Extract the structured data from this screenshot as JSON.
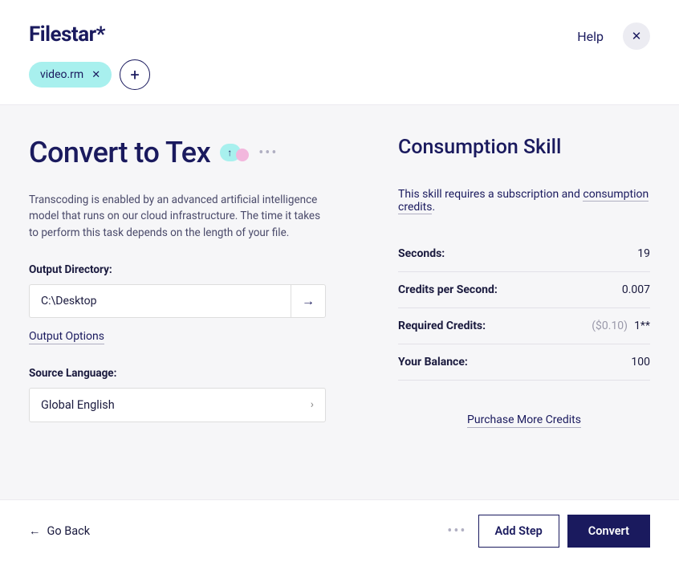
{
  "header": {
    "logo": "Filestar*",
    "file_chip": "video.rm",
    "help": "Help"
  },
  "main": {
    "title": "Convert to Tex",
    "description": "Transcoding is enabled by an advanced artificial intelligence model that runs on our cloud infrastructure. The time it takes to perform this task depends on the length of your file.",
    "output_dir_label": "Output Directory:",
    "output_dir_value": "C:\\Desktop",
    "output_options": "Output Options",
    "source_lang_label": "Source Language:",
    "source_lang_value": "Global English"
  },
  "consumption": {
    "title": "Consumption Skill",
    "req_pre": "This skill requires a subscription and ",
    "req_link": "consumption credits",
    "req_post": ".",
    "rows": [
      {
        "label": "Seconds:",
        "value": "19"
      },
      {
        "label": "Credits per Second:",
        "value": "0.007"
      },
      {
        "label": "Required Credits:",
        "cost": "($0.10)",
        "value": "1**"
      },
      {
        "label": "Your Balance:",
        "value": "100"
      }
    ],
    "purchase": "Purchase More Credits"
  },
  "footer": {
    "back": "Go Back",
    "add_step": "Add Step",
    "convert": "Convert"
  }
}
